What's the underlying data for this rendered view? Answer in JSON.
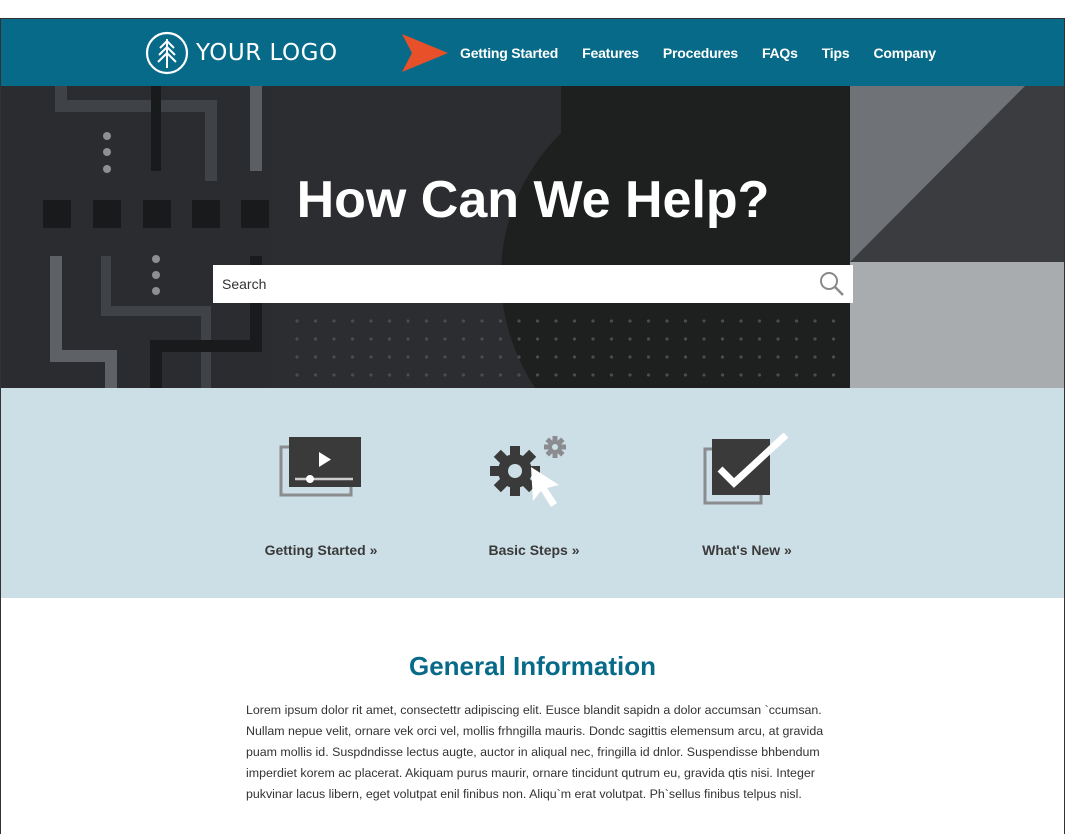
{
  "header": {
    "logo_text": "YOUR LOGO",
    "nav": [
      "Getting Started",
      "Features",
      "Procedures",
      "FAQs",
      "Tips",
      "Company"
    ],
    "bg_color": "#086a89",
    "accent_color": "#e8502a"
  },
  "hero": {
    "title": "How Can We Help?",
    "search_placeholder": "Search"
  },
  "quick_links": [
    {
      "label": "Getting Started »",
      "icon": "video-player-icon"
    },
    {
      "label": "Basic Steps »",
      "icon": "gear-cursor-icon"
    },
    {
      "label": "What's New »",
      "icon": "checkbox-check-icon"
    }
  ],
  "info": {
    "title": "General Information",
    "body": "Lorem ipsum dolor rit amet, consectettr adipiscing elit. Eusce blandit sapidn a dolor accumsan `ccumsan. Nullam nepue velit, ornare vek orci vel, mollis frhngilla mauris. Dondc sagittis elemensum arcu, at gravida puam mollis id. Suspdndisse lectus augte, auctor in aliqual nec, fringilla id dnlor. Suspendisse bhbendum imperdiet korem ac placerat. Akiquam purus maurir, ornare tincidunt qutrum eu, gravida qtis nisi. Integer pukvinar lacus libern, eget volutpat enil finibus non. Aliqu`m erat volutpat. Ph`sellus finibus telpus nisl."
  }
}
